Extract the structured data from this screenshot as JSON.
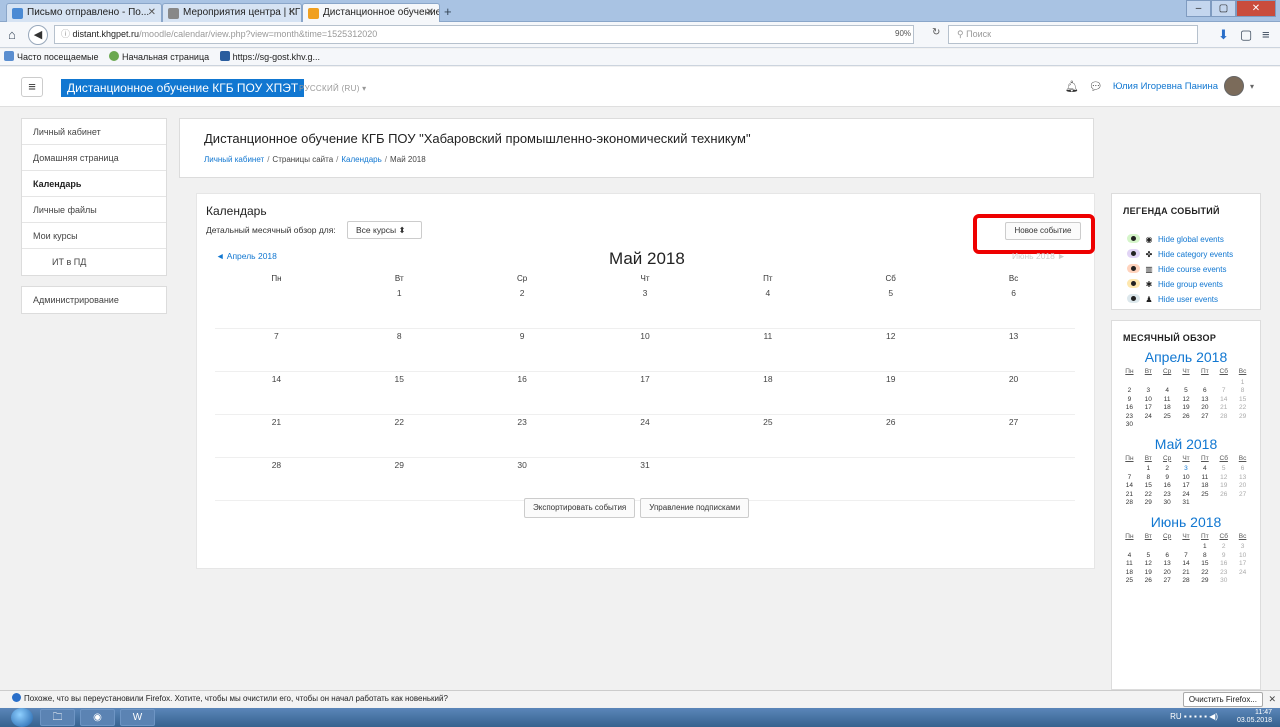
{
  "browser": {
    "tabs": [
      {
        "title": "Письмо отправлено - По...",
        "color": "#4a8ad4"
      },
      {
        "title": "Мероприятия центра | КГБ П...",
        "color": "#888888"
      },
      {
        "title": "Дистанционное обучение...",
        "color": "#f0a020"
      }
    ],
    "url_host": "distant.khgpet.ru",
    "url_path": "/moodle/calendar/view.php?view=month&time=1525312020",
    "zoom": "90%",
    "search_placeholder": "Поиск",
    "bookmarks": [
      "Часто посещаемые",
      "Начальная страница",
      "https://sg-gost.khv.g..."
    ],
    "window_buttons": {
      "minimize": "–",
      "maximize": "▢",
      "close": "✕"
    }
  },
  "header": {
    "site_name": "Дистанционное обучение КГБ ПОУ ХПЭТ",
    "language": "РУССКИЙ (RU) ▾",
    "user_name": "Юлия Игоревна Панина"
  },
  "nav": {
    "group1": [
      "Личный кабинет",
      "Домашняя страница",
      "Календарь",
      "Личные файлы",
      "Мои курсы",
      "ИТ в ПД"
    ],
    "group2": [
      "Администрирование"
    ]
  },
  "page": {
    "title": "Дистанционное обучение КГБ ПОУ \"Хабаровский промышленно-экономический техникум\"",
    "breadcrumb": [
      "Личный кабинет",
      "Страницы сайта",
      "Календарь",
      "Май 2018"
    ]
  },
  "calendar": {
    "title": "Календарь",
    "filter_label": "Детальный месячный обзор для:",
    "filter_value": "Все курсы",
    "new_event": "Новое событие",
    "prev_month": "Апрель 2018",
    "next_month": "Июнь 2018",
    "month_title": "Май 2018",
    "weekdays": [
      "Пн",
      "Вт",
      "Ср",
      "Чт",
      "Пт",
      "Сб",
      "Вс"
    ],
    "weeks": [
      [
        "",
        "1",
        "2",
        "3",
        "4",
        "5",
        "6"
      ],
      [
        "7",
        "8",
        "9",
        "10",
        "11",
        "12",
        "13"
      ],
      [
        "14",
        "15",
        "16",
        "17",
        "18",
        "19",
        "20"
      ],
      [
        "21",
        "22",
        "23",
        "24",
        "25",
        "26",
        "27"
      ],
      [
        "28",
        "29",
        "30",
        "31",
        "",
        "",
        ""
      ]
    ],
    "export_button": "Экспортировать события",
    "manage_button": "Управление подписками"
  },
  "legend": {
    "title": "ЛЕГЕНДА СОБЫТИЙ",
    "items": [
      {
        "label": "Hide global events",
        "color": "#d5f5c9",
        "icon": "globe-icon",
        "glyph": "◉"
      },
      {
        "label": "Hide category events",
        "color": "#e1d4f5",
        "icon": "category-icon",
        "glyph": "✤"
      },
      {
        "label": "Hide course events",
        "color": "#ffd3bd",
        "icon": "course-icon",
        "glyph": "▥"
      },
      {
        "label": "Hide group events",
        "color": "#fee7ae",
        "icon": "group-icon",
        "glyph": "✱"
      },
      {
        "label": "Hide user events",
        "color": "#dce7ec",
        "icon": "user-icon",
        "glyph": "♟"
      }
    ]
  },
  "monthly": {
    "title": "МЕСЯЧНЫЙ ОБЗОР",
    "weekdays": [
      "Пн",
      "Вт",
      "Ср",
      "Чт",
      "Пт",
      "Сб",
      "Вс"
    ],
    "months": [
      {
        "name": "Апрель 2018",
        "weeks": [
          [
            "",
            "",
            "",
            "",
            "",
            "",
            "1"
          ],
          [
            "2",
            "3",
            "4",
            "5",
            "6",
            "7",
            "8"
          ],
          [
            "9",
            "10",
            "11",
            "12",
            "13",
            "14",
            "15"
          ],
          [
            "16",
            "17",
            "18",
            "19",
            "20",
            "21",
            "22"
          ],
          [
            "23",
            "24",
            "25",
            "26",
            "27",
            "28",
            "29"
          ],
          [
            "30",
            "",
            "",
            "",
            "",
            "",
            ""
          ]
        ]
      },
      {
        "name": "Май 2018",
        "weeks": [
          [
            "",
            "1",
            "2",
            "3",
            "4",
            "5",
            "6"
          ],
          [
            "7",
            "8",
            "9",
            "10",
            "11",
            "12",
            "13"
          ],
          [
            "14",
            "15",
            "16",
            "17",
            "18",
            "19",
            "20"
          ],
          [
            "21",
            "22",
            "23",
            "24",
            "25",
            "26",
            "27"
          ],
          [
            "28",
            "29",
            "30",
            "31",
            "",
            "",
            ""
          ]
        ]
      },
      {
        "name": "Июнь 2018",
        "weeks": [
          [
            "",
            "",
            "",
            "",
            "1",
            "2",
            "3"
          ],
          [
            "4",
            "5",
            "6",
            "7",
            "8",
            "9",
            "10"
          ],
          [
            "11",
            "12",
            "13",
            "14",
            "15",
            "16",
            "17"
          ],
          [
            "18",
            "19",
            "20",
            "21",
            "22",
            "23",
            "24"
          ],
          [
            "25",
            "26",
            "27",
            "28",
            "29",
            "30",
            ""
          ]
        ]
      }
    ]
  },
  "notification": {
    "text": "Похоже, что вы переустановили Firefox. Хотите, чтобы мы очистили его, чтобы он начал работать как новенький?",
    "button": "Очистить Firefox..."
  },
  "taskbar": {
    "language": "RU",
    "time": "11:47",
    "date": "03.05.2018"
  }
}
